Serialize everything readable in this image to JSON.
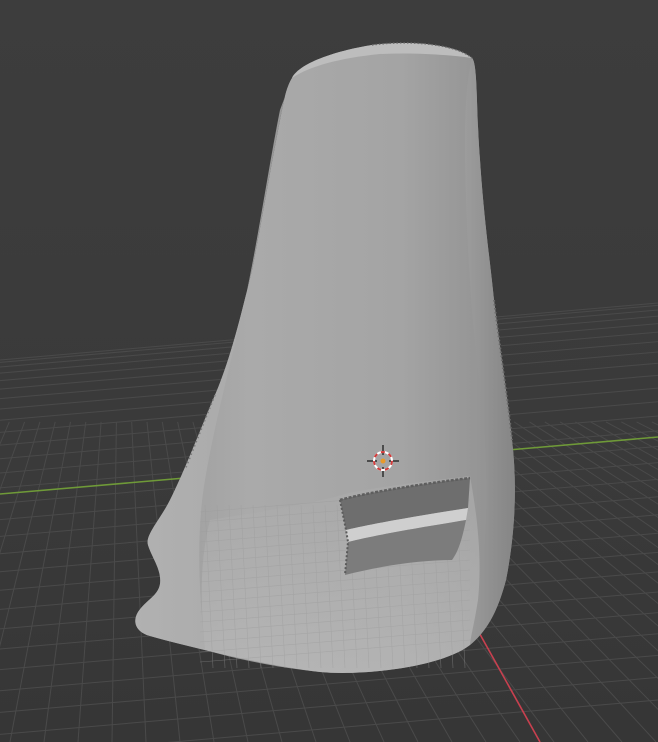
{
  "viewport": {
    "view": "3d-viewport",
    "background_color": "#3c3c3c",
    "grid_color": "#4a4a4a",
    "x_axis_color": "#c8404f",
    "y_axis_color": "#7aa83c",
    "object_color": "#a2a2a2",
    "cursor_icon": "3d-cursor-icon"
  }
}
